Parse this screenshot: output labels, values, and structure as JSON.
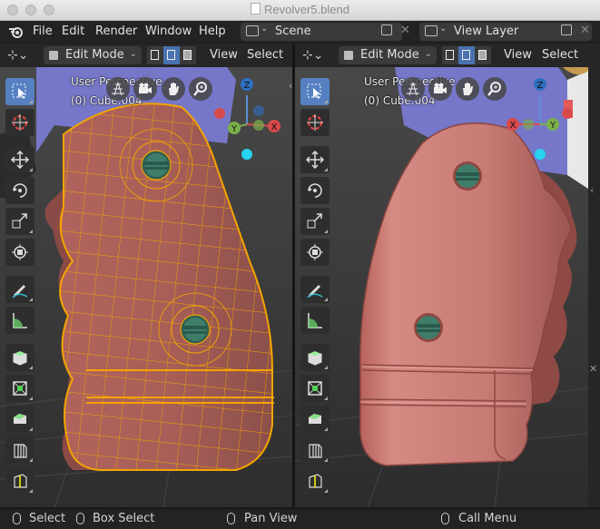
{
  "window": {
    "title": "Revolver5.blend"
  },
  "topbar": {
    "menus": [
      "File",
      "Edit",
      "Render",
      "Window",
      "Help"
    ],
    "scene": {
      "label": "Scene"
    },
    "view_layer": {
      "label": "View Layer"
    }
  },
  "viewports": [
    {
      "mode": "Edit Mode",
      "menus": [
        "View",
        "Select"
      ],
      "perspective": "User Perspective",
      "object": "(0) Cube.004",
      "shading": "wireframe-edit"
    },
    {
      "mode": "Edit Mode",
      "menus": [
        "View",
        "Select"
      ],
      "perspective": "User Perspective",
      "object": "(0) Cube.004",
      "shading": "solid"
    }
  ],
  "gizmo": {
    "x": "X",
    "y": "Y",
    "z": "Z"
  },
  "toolbar_tools": [
    "select-box-icon",
    "cursor-icon",
    "move-icon",
    "rotate-icon",
    "scale-icon",
    "transform-icon",
    "annotate-icon",
    "measure-icon",
    "add-cube-icon",
    "extrude-icon",
    "inset-icon",
    "bevel-icon",
    "loop-cut-icon"
  ],
  "statusbar": {
    "select": "Select",
    "box_select": "Box Select",
    "pan_view": "Pan View",
    "call_menu": "Call Menu"
  },
  "colors": {
    "mesh_body": "#c4766e",
    "wire": "#f4a400",
    "screw": "#3f7d6b",
    "background_blue": "#7677c9",
    "active_tool": "#5680c2"
  }
}
